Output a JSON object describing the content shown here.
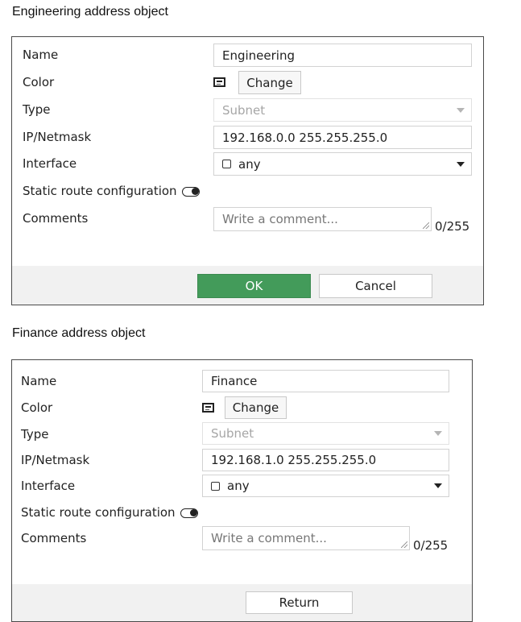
{
  "engineering": {
    "section_title": "Engineering address object",
    "name_label": "Name",
    "name_value": "Engineering",
    "color_label": "Color",
    "color_button": "Change",
    "type_label": "Type",
    "type_value": "Subnet",
    "ip_label": "IP/Netmask",
    "ip_value": "192.168.0.0 255.255.255.0",
    "interface_label": "Interface",
    "interface_value": "any",
    "static_route_label": "Static route configuration",
    "comments_label": "Comments",
    "comments_placeholder": "Write a comment...",
    "comments_counter": "0/255",
    "ok_button": "OK",
    "cancel_button": "Cancel"
  },
  "finance": {
    "section_title": "Finance address object",
    "name_label": "Name",
    "name_value": "Finance",
    "color_label": "Color",
    "color_button": "Change",
    "type_label": "Type",
    "type_value": "Subnet",
    "ip_label": "IP/Netmask",
    "ip_value": "192.168.1.0 255.255.255.0",
    "interface_label": "Interface",
    "interface_value": "any",
    "static_route_label": "Static route configuration",
    "comments_label": "Comments",
    "comments_placeholder": "Write a comment...",
    "comments_counter": "0/255",
    "return_button": "Return"
  },
  "colors": {
    "ok_button_bg": "#439b5a",
    "panel_border": "#4a4a4a",
    "footer_bg": "#f1f1f1"
  },
  "icons": {
    "color_swatch": "color-swatch-icon",
    "interface_checkbox": "checkbox-icon",
    "dropdown": "chevron-down-icon",
    "toggle": "toggle-switch-icon"
  }
}
